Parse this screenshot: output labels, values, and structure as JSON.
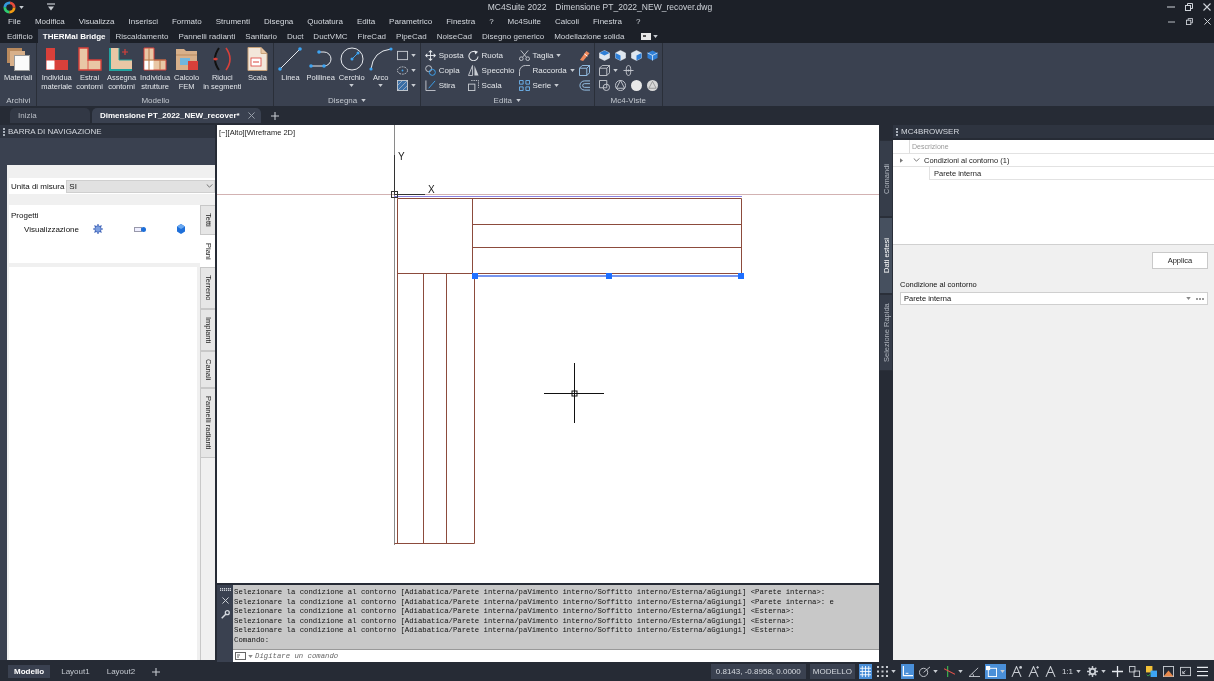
{
  "window": {
    "app": "MC4Suite 2022",
    "file": "Dimensione PT_2022_NEW_recover.dwg"
  },
  "menu": [
    "File",
    "Modifica",
    "Visualizza",
    "Inserisci",
    "Formato",
    "Strumenti",
    "Disegna",
    "Quotatura",
    "Edita",
    "Parametrico",
    "Finestra",
    "?",
    "Mc4Suite",
    "Calcoli",
    "Finestra",
    "?"
  ],
  "ribbon_tabs": [
    {
      "label": "Edificio",
      "selected": false
    },
    {
      "label": "THERMal Bridge",
      "selected": true
    },
    {
      "label": "Riscaldamento",
      "selected": false
    },
    {
      "label": "Pannelli radianti",
      "selected": false
    },
    {
      "label": "Sanitario",
      "selected": false
    },
    {
      "label": "Duct",
      "selected": false
    },
    {
      "label": "DuctVMC",
      "selected": false
    },
    {
      "label": "FireCad",
      "selected": false
    },
    {
      "label": "PipeCad",
      "selected": false
    },
    {
      "label": "NoiseCad",
      "selected": false
    },
    {
      "label": "Disegno generico",
      "selected": false
    },
    {
      "label": "Modellazione solida",
      "selected": false
    }
  ],
  "ribbon_panels": [
    {
      "title": "Archivi",
      "menu": false,
      "columns": [
        [
          {
            "kind": "large",
            "label": "Materiali",
            "caret": false
          }
        ]
      ]
    },
    {
      "title": "Modello",
      "menu": false,
      "columns": [
        [
          {
            "kind": "large",
            "label": "Individua\nmateriale",
            "caret": false
          }
        ],
        [
          {
            "kind": "large",
            "label": "Estrai\ncontorni",
            "caret": false
          }
        ],
        [
          {
            "kind": "large",
            "label": "Assegna\ncontorni",
            "caret": false
          }
        ],
        [
          {
            "kind": "large",
            "label": "Individua\nstrutture",
            "caret": false
          }
        ],
        [
          {
            "kind": "large",
            "label": "Calcolo\nFEM",
            "caret": false
          }
        ],
        [
          {
            "kind": "large",
            "label": "Riduci\nin segmenti",
            "caret": false
          }
        ],
        [
          {
            "kind": "large",
            "label": "Scala",
            "caret": false
          }
        ]
      ]
    },
    {
      "title": "Disegna",
      "menu": true,
      "columns": [
        [
          {
            "kind": "large",
            "label": "Linea",
            "caret": false
          }
        ],
        [
          {
            "kind": "large",
            "label": "Polilinea",
            "caret": false
          }
        ],
        [
          {
            "kind": "large",
            "label": "Cerchio",
            "caret": true
          }
        ],
        [
          {
            "kind": "large",
            "label": "Arco",
            "caret": true
          }
        ],
        [
          {
            "kind": "icon",
            "caret": true
          },
          {
            "kind": "icon",
            "caret": true
          },
          {
            "kind": "icon",
            "caret": true
          }
        ]
      ]
    },
    {
      "title": "Edita",
      "menu": true,
      "columns": [
        [
          {
            "kind": "small",
            "label": "Sposta",
            "caret": false
          },
          {
            "kind": "small",
            "label": "Copia",
            "caret": false
          },
          {
            "kind": "small",
            "label": "Stira",
            "caret": false
          }
        ],
        [
          {
            "kind": "small",
            "label": "Ruota",
            "caret": false
          },
          {
            "kind": "small",
            "label": "Specchio",
            "caret": false
          },
          {
            "kind": "small",
            "label": "Scala",
            "caret": false
          }
        ],
        [
          {
            "kind": "small",
            "label": "Taglia",
            "caret": true
          },
          {
            "kind": "small",
            "label": "Raccorda",
            "caret": true
          },
          {
            "kind": "small",
            "label": "Serie",
            "caret": true
          }
        ],
        [
          {
            "kind": "icon",
            "caret": false
          },
          {
            "kind": "icon",
            "caret": false
          },
          {
            "kind": "icon",
            "caret": false
          }
        ]
      ]
    },
    {
      "title": "Mc4-Viste",
      "menu": false,
      "rows": [
        [
          {
            "kind": "icon",
            "caret": false
          },
          {
            "kind": "icon",
            "caret": false
          },
          {
            "kind": "icon",
            "caret": false
          },
          {
            "kind": "icon",
            "caret": false
          }
        ],
        [
          {
            "kind": "icon",
            "caret": true
          },
          {
            "kind": "icon",
            "caret": false
          }
        ],
        [
          {
            "kind": "icon",
            "caret": false
          },
          {
            "kind": "icon",
            "caret": false
          },
          {
            "kind": "icon",
            "caret": false
          },
          {
            "kind": "icon",
            "caret": false
          }
        ]
      ]
    }
  ],
  "doc_tabs": [
    {
      "label": "Inizia",
      "selected": false,
      "closable": false
    },
    {
      "label": "Dimensione PT_2022_NEW_recover*",
      "selected": true,
      "closable": true
    }
  ],
  "navigation": {
    "title": "BARRA DI NAVIGAZIONE",
    "unit_label": "Unita di misura",
    "unit_value": "SI",
    "tree": [
      {
        "label": "Progetti",
        "children": [
          {
            "label": "Visualizzazione"
          }
        ]
      }
    ],
    "side_tabs": [
      {
        "label": "Tetti",
        "selected": false
      },
      {
        "label": "Piani",
        "selected": true
      },
      {
        "label": "Terreno",
        "selected": false
      },
      {
        "label": "Impianti",
        "selected": false
      },
      {
        "label": "Canali",
        "selected": false
      },
      {
        "label": "Pannelli radianti",
        "selected": false
      }
    ]
  },
  "viewport": {
    "controls": [
      "[−]",
      "[Alto]",
      "[Wireframe 2D]"
    ],
    "ucs": {
      "x_label": "X",
      "y_label": "Y"
    }
  },
  "command_line": {
    "history": [
      "Selezionare la condizione al contorno [Adiabatica/Parete interna/paVimento interno/Soffitto interno/Esterna/aGgiungi] <Parete interna>:",
      "Selezionare la condizione al contorno [Adiabatica/Parete interna/paVimento interno/Soffitto interno/Esterna/aGgiungi] <Parete interna>: e",
      "Selezionare la condizione al contorno [Adiabatica/Parete interna/paVimento interno/Soffitto interno/Esterna/aGgiungi] <Esterna>:",
      "Selezionare la condizione al contorno [Adiabatica/Parete interna/paVimento interno/Soffitto interno/Esterna/aGgiungi] <Esterna>:",
      "Selezionare la condizione al contorno [Adiabatica/Parete interna/paVimento interno/Soffitto interno/Esterna/aGgiungi] <Esterna>:",
      "Comando:"
    ],
    "placeholder": "Digitare un comando"
  },
  "browser": {
    "title": "MC4BROWSER",
    "side_tabs": [
      {
        "label": "Comandi",
        "selected": false
      },
      {
        "label": "Dati estesi",
        "selected": true
      },
      {
        "label": "Selezione Rapida",
        "selected": false
      }
    ],
    "column": "Descrizione",
    "rows": [
      {
        "label": "Condizioni al contorno (1)",
        "expanded": true,
        "children": [
          {
            "label": "Parete interna"
          }
        ]
      }
    ],
    "apply_button": "Applica",
    "field_label": "Condizione al contorno",
    "field_value": "Parete interna"
  },
  "status_bar": {
    "layout_tabs": [
      {
        "label": "Modello",
        "selected": true
      },
      {
        "label": "Layout1",
        "selected": false
      },
      {
        "label": "Layout2",
        "selected": false
      }
    ],
    "coordinates": "0.8143, -0.8958, 0.0000",
    "space": "MODELLO",
    "items": [
      {
        "kind": "toggle",
        "on": true,
        "caret": false
      },
      {
        "kind": "toggle",
        "on": false,
        "caret": true
      },
      {
        "kind": "toggle",
        "on": true,
        "caret": false
      },
      {
        "kind": "toggle",
        "on": false,
        "caret": true
      },
      {
        "kind": "toggle",
        "on": false,
        "caret": true
      },
      {
        "kind": "toggle",
        "on": false,
        "caret": false
      },
      {
        "kind": "toggle",
        "on": true,
        "caret": true
      },
      {
        "kind": "toggle",
        "on": false,
        "caret": false
      },
      {
        "kind": "toggle",
        "on": false,
        "caret": false
      },
      {
        "kind": "toggle",
        "on": false,
        "caret": false
      },
      {
        "kind": "text",
        "label": "1:1",
        "caret": true
      },
      {
        "kind": "button",
        "caret": true
      },
      {
        "kind": "button",
        "caret": false
      },
      {
        "kind": "button",
        "caret": false
      },
      {
        "kind": "button",
        "caret": false
      },
      {
        "kind": "button",
        "caret": false
      },
      {
        "kind": "button",
        "caret": false
      },
      {
        "kind": "button",
        "caret": false
      }
    ]
  }
}
